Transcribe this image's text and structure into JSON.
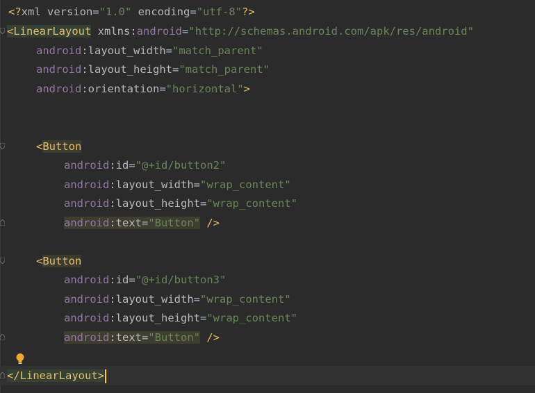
{
  "editor": {
    "language": "xml",
    "lines": {
      "l1": {
        "open": "<?",
        "name": "xml",
        "attr1": " version",
        "eq1": "=",
        "val1": "\"1.0\"",
        "attr2": " encoding",
        "eq2": "=",
        "val2": "\"utf-8\"",
        "close": "?>"
      },
      "l2": {
        "open": "<",
        "tag": "LinearLayout",
        "space": " ",
        "attr": "xmlns",
        "colon": ":",
        "ns": "android",
        "eq": "=",
        "val": "\"http://schemas.android.com/apk/res/android\""
      },
      "l3": {
        "ns": "android",
        "colon": ":",
        "attr": "layout_width",
        "eq": "=",
        "val": "\"match_parent\""
      },
      "l4": {
        "ns": "android",
        "colon": ":",
        "attr": "layout_height",
        "eq": "=",
        "val": "\"match_parent\""
      },
      "l5": {
        "ns": "android",
        "colon": ":",
        "attr": "orientation",
        "eq": "=",
        "val": "\"horizontal\"",
        "close": ">"
      },
      "b1": {
        "open": "<",
        "tag": "Button",
        "id": {
          "ns": "android",
          "colon": ":",
          "attr": "id",
          "eq": "=",
          "val": "\"@+id/button2\""
        },
        "w": {
          "ns": "android",
          "colon": ":",
          "attr": "layout_width",
          "eq": "=",
          "val": "\"wrap_content\""
        },
        "h": {
          "ns": "android",
          "colon": ":",
          "attr": "layout_height",
          "eq": "=",
          "val": "\"wrap_content\""
        },
        "t": {
          "ns": "android",
          "colon": ":",
          "attr": "text",
          "eq": "=",
          "val": "\"Button\"",
          "close": " />"
        }
      },
      "b2": {
        "open": "<",
        "tag": "Button",
        "id": {
          "ns": "android",
          "colon": ":",
          "attr": "id",
          "eq": "=",
          "val": "\"@+id/button3\""
        },
        "w": {
          "ns": "android",
          "colon": ":",
          "attr": "layout_width",
          "eq": "=",
          "val": "\"wrap_content\""
        },
        "h": {
          "ns": "android",
          "colon": ":",
          "attr": "layout_height",
          "eq": "=",
          "val": "\"wrap_content\""
        },
        "t": {
          "ns": "android",
          "colon": ":",
          "attr": "text",
          "eq": "=",
          "val": "\"Button\"",
          "close": " />"
        }
      },
      "end": {
        "open": "</",
        "tag": "LinearLayout",
        "close": ">"
      }
    }
  },
  "icons": {
    "bulb": "lightbulb-icon",
    "fold": "fold-marker-icon"
  },
  "colors": {
    "background": "#2b2b2b",
    "tag": "#e8bf6a",
    "namespace": "#9876aa",
    "value": "#6a8759",
    "attribute": "#bababa",
    "cursor": "#ffcc33"
  }
}
